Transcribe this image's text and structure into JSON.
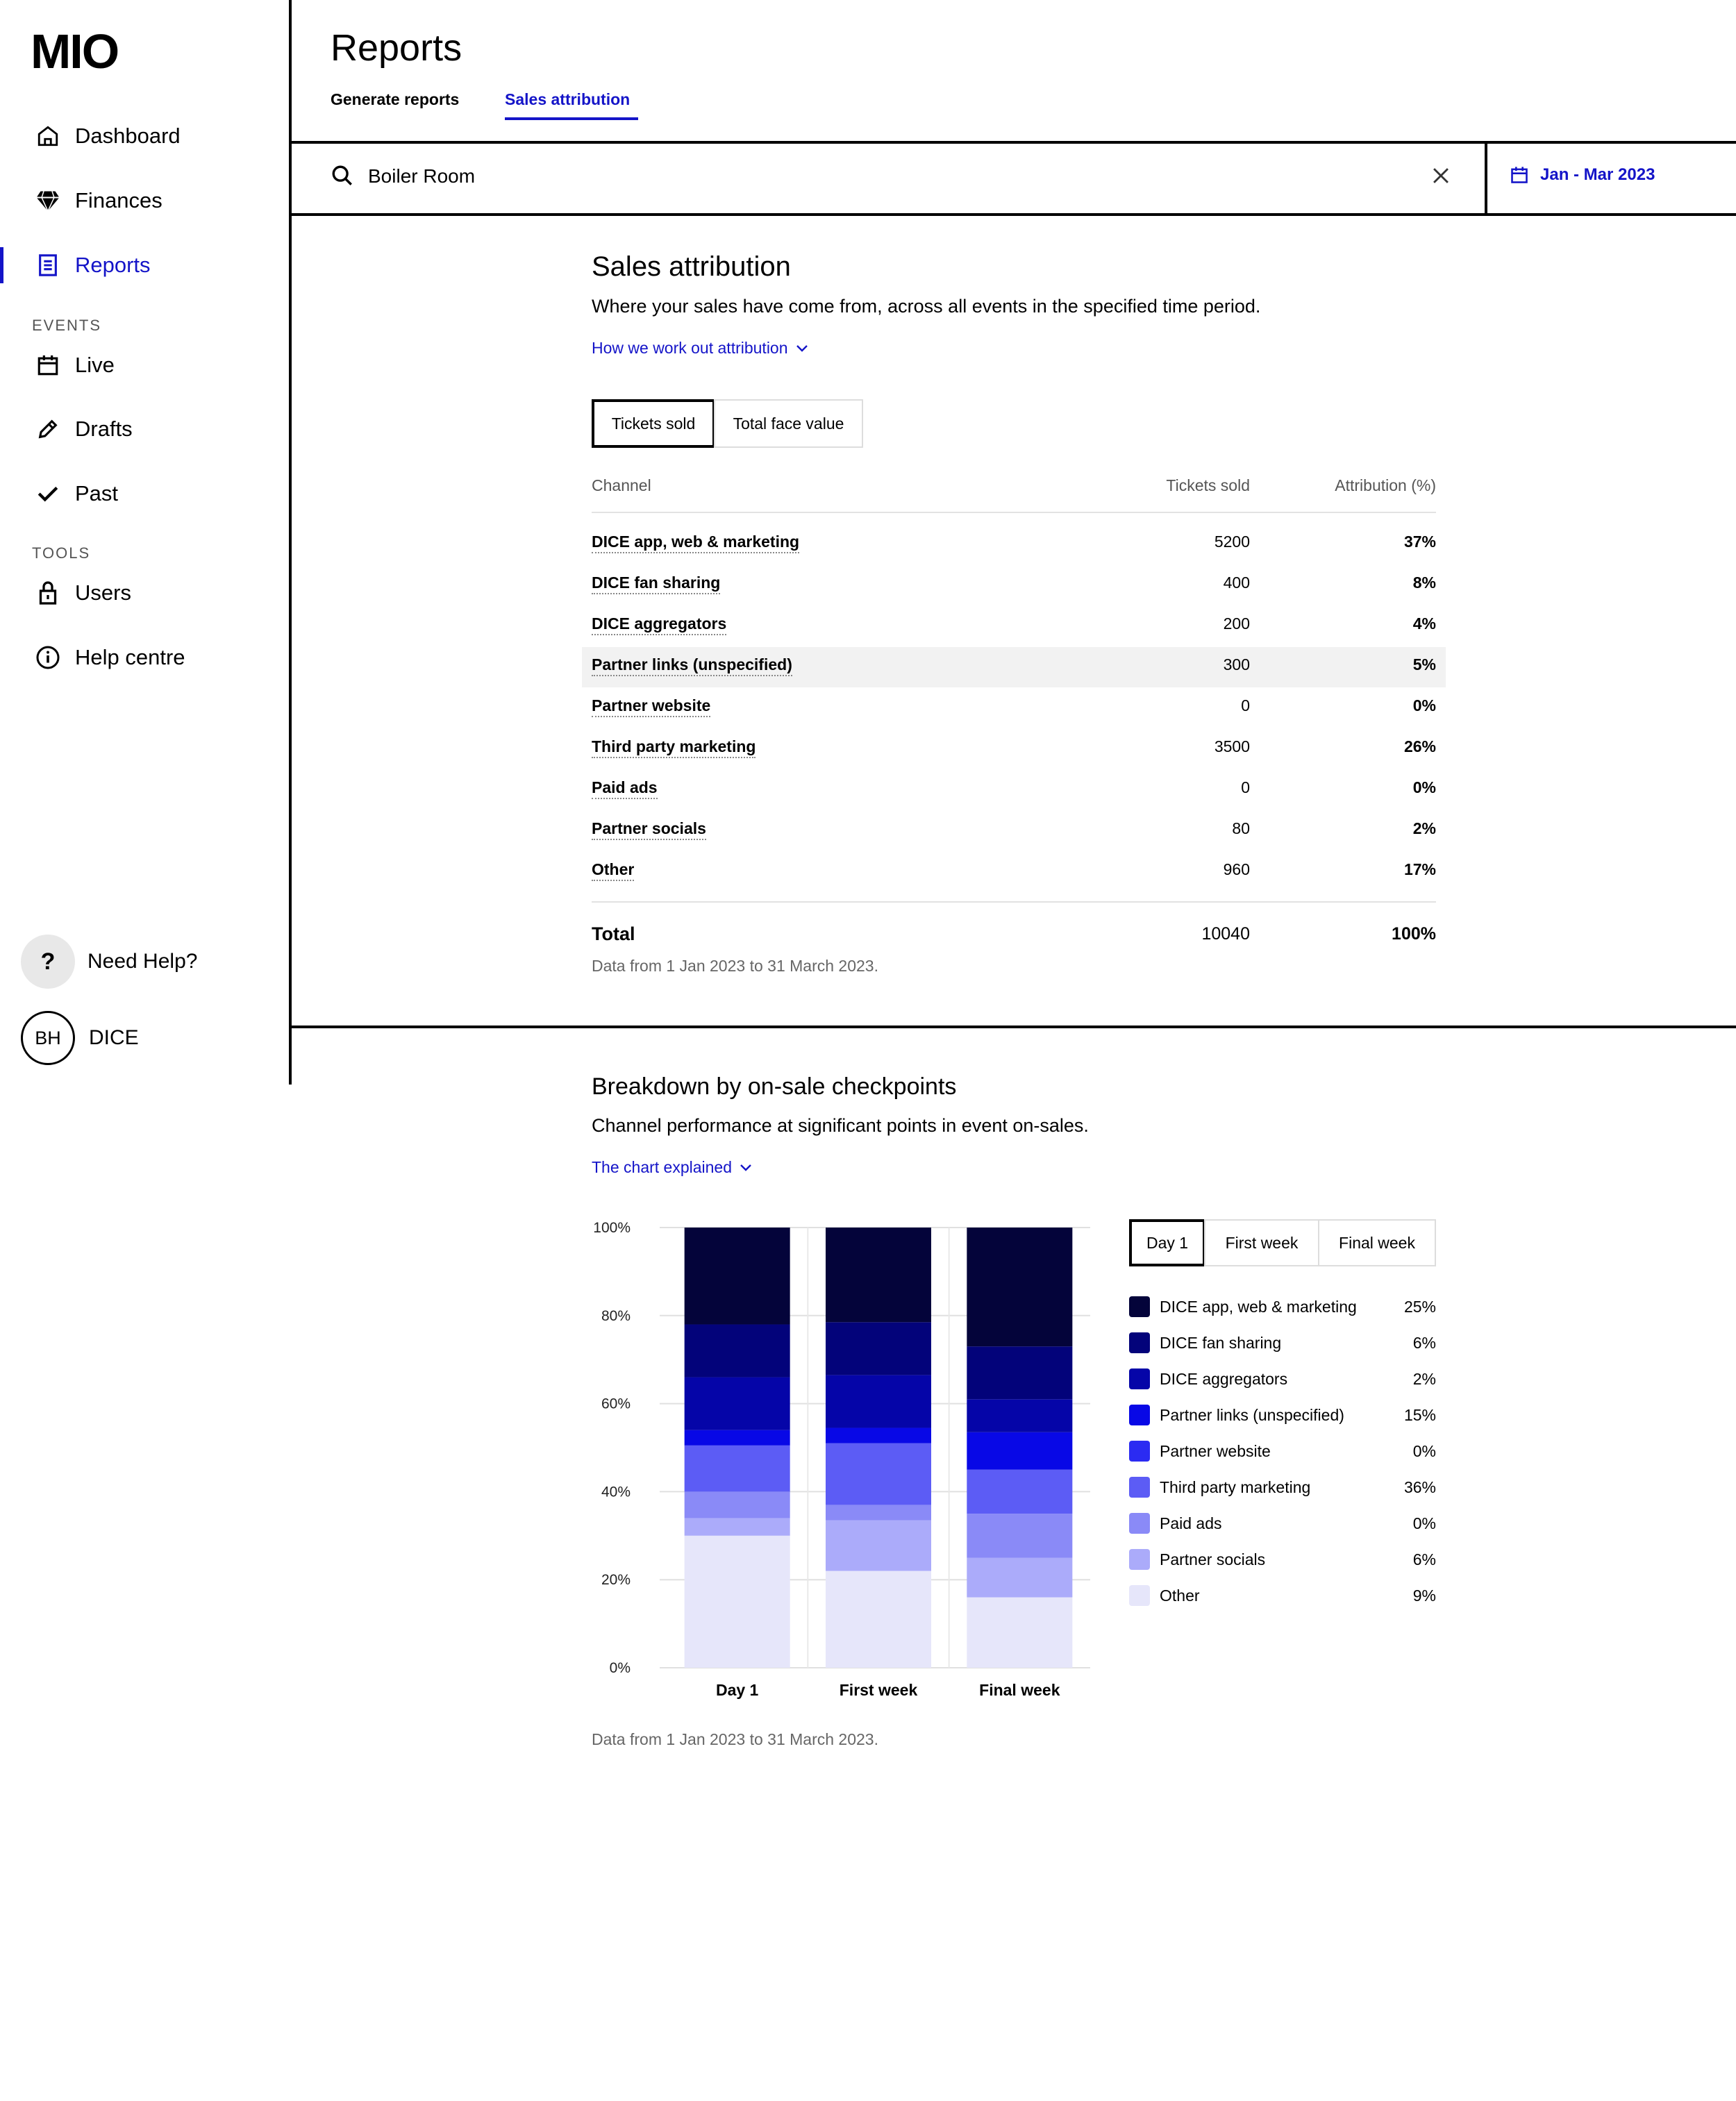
{
  "app": {
    "logo": "MIO"
  },
  "sidebar": {
    "items": [
      {
        "label": "Dashboard",
        "icon": "home-icon"
      },
      {
        "label": "Finances",
        "icon": "gem-icon"
      },
      {
        "label": "Reports",
        "icon": "document-icon",
        "active": true
      },
      {
        "label": "Live",
        "icon": "calendar-icon"
      },
      {
        "label": "Drafts",
        "icon": "pencil-icon"
      },
      {
        "label": "Past",
        "icon": "check-icon"
      },
      {
        "label": "Users",
        "icon": "lock-icon"
      },
      {
        "label": "Help centre",
        "icon": "info-icon"
      }
    ],
    "sections": {
      "events": "EVENTS",
      "tools": "TOOLS"
    },
    "help": {
      "icon_text": "?",
      "label": "Need Help?"
    },
    "user": {
      "initials": "BH",
      "name": "DICE"
    }
  },
  "header": {
    "title": "Reports",
    "tabs": [
      {
        "label": "Generate reports"
      },
      {
        "label": "Sales attribution",
        "active": true
      }
    ],
    "search": {
      "value": "Boiler Room"
    },
    "date_range": "Jan - Mar 2023"
  },
  "attribution": {
    "title": "Sales attribution",
    "subtitle": "Where your sales have come from, across all events in the specified time period.",
    "link": "How we work out attribution",
    "toggles": [
      "Tickets sold",
      "Total face value"
    ],
    "columns": [
      "Channel",
      "Tickets sold",
      "Attribution (%)"
    ],
    "rows": [
      {
        "channel": "DICE app, web & marketing",
        "tickets": "5200",
        "pct": "37%"
      },
      {
        "channel": "DICE fan sharing",
        "tickets": "400",
        "pct": "8%"
      },
      {
        "channel": "DICE aggregators",
        "tickets": "200",
        "pct": "4%"
      },
      {
        "channel": "Partner links (unspecified)",
        "tickets": "300",
        "pct": "5%"
      },
      {
        "channel": "Partner website",
        "tickets": "0",
        "pct": "0%"
      },
      {
        "channel": "Third party marketing",
        "tickets": "3500",
        "pct": "26%"
      },
      {
        "channel": "Paid ads",
        "tickets": "0",
        "pct": "0%"
      },
      {
        "channel": "Partner socials",
        "tickets": "80",
        "pct": "2%"
      },
      {
        "channel": "Other",
        "tickets": "960",
        "pct": "17%"
      }
    ],
    "total": {
      "label": "Total",
      "tickets": "10040",
      "pct": "100%"
    },
    "note": "Data from 1 Jan 2023 to 31 March 2023."
  },
  "breakdown": {
    "title": "Breakdown by on-sale checkpoints",
    "subtitle": "Channel performance at significant points in event on-sales.",
    "link": "The chart explained",
    "toggles": [
      "Day 1",
      "First week",
      "Final week"
    ],
    "legend": [
      {
        "label": "DICE app, web & marketing",
        "value": "25%"
      },
      {
        "label": "DICE fan sharing",
        "value": "6%"
      },
      {
        "label": "DICE aggregators",
        "value": "2%"
      },
      {
        "label": "Partner links (unspecified)",
        "value": "15%"
      },
      {
        "label": "Partner website",
        "value": "0%"
      },
      {
        "label": "Third party marketing",
        "value": "36%"
      },
      {
        "label": "Paid ads",
        "value": "0%"
      },
      {
        "label": "Partner socials",
        "value": "6%"
      },
      {
        "label": "Other",
        "value": "9%"
      }
    ],
    "note": "Data from 1 Jan 2023 to 31 March 2023."
  },
  "chart_data": {
    "type": "bar",
    "stacked": true,
    "categories": [
      "Day 1",
      "First week",
      "Final week"
    ],
    "y_ticks": [
      "0%",
      "20%",
      "40%",
      "60%",
      "80%",
      "100%"
    ],
    "ylim": [
      0,
      100
    ],
    "grid": true,
    "series": [
      {
        "name": "Other",
        "color": "#e6e6fa",
        "values": [
          30,
          22,
          16
        ]
      },
      {
        "name": "Partner socials",
        "color": "#ababfa",
        "values": [
          4,
          11.5,
          9
        ]
      },
      {
        "name": "Paid ads",
        "color": "#8a8af7",
        "values": [
          6,
          3.5,
          10
        ]
      },
      {
        "name": "Third party marketing",
        "color": "#5c5cf5",
        "values": [
          10.5,
          14,
          10
        ]
      },
      {
        "name": "Partner website",
        "color": "#2b2bf2",
        "values": [
          0,
          0,
          0
        ]
      },
      {
        "name": "Partner links (unspecified)",
        "color": "#0808e6",
        "values": [
          3.5,
          3.5,
          8.5
        ]
      },
      {
        "name": "DICE aggregators",
        "color": "#0505a8",
        "values": [
          12,
          12,
          7.5
        ]
      },
      {
        "name": "DICE fan sharing",
        "color": "#03037a",
        "values": [
          12,
          12,
          12
        ]
      },
      {
        "name": "DICE app, web & marketing",
        "color": "#04043a",
        "values": [
          22,
          21.5,
          27
        ]
      }
    ]
  }
}
